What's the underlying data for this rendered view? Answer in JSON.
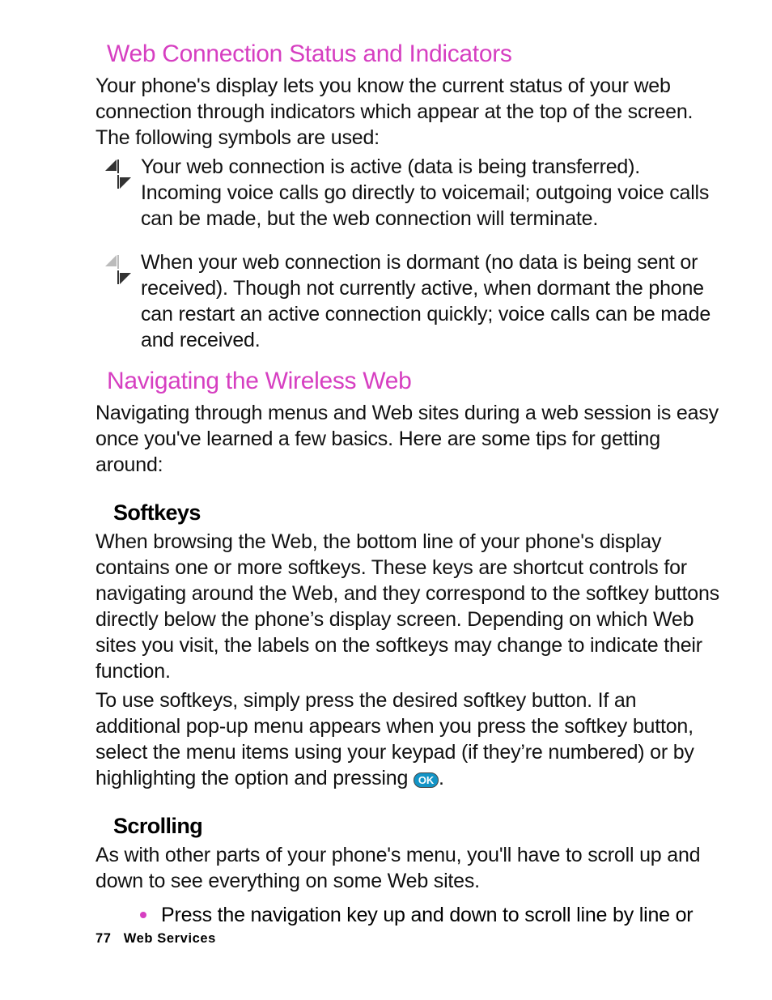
{
  "sections": {
    "webConn": {
      "title": "Web Connection Status and Indicators",
      "intro": "Your phone's display lets you know the current status of your web connection through indicators which appear at the top of the screen. The following symbols are used:",
      "icon1_text": "Your web connection is active (data is being transferred). Incoming voice calls go directly to voicemail; outgoing voice calls can be made, but the web connection will terminate.",
      "icon2_text": "When your web connection is dormant (no data is being sent or received). Though not currently active, when dormant the phone can restart an active connection quickly; voice calls can be made and received."
    },
    "nav": {
      "title": "Navigating the Wireless Web",
      "intro": "Navigating through menus and Web sites during a web session is easy once you've learned a few basics. Here are some tips for getting around:"
    },
    "softkeys": {
      "title": "Softkeys",
      "p1": "When browsing the Web, the bottom line of your phone's display contains one or more softkeys. These keys are shortcut controls for navigating around the Web, and they correspond to the softkey buttons directly below the phone’s display screen. Depending on which Web sites you visit, the labels on the softkeys may change to indicate their function.",
      "p2_a": "To use softkeys, simply press the desired softkey button. If an additional pop-up menu appears when you press the softkey button, select the menu items using your keypad (if they’re numbered) or by highlighting the option and pressing ",
      "p2_ok": "OK",
      "p2_b": "."
    },
    "scrolling": {
      "title": "Scrolling",
      "p1": "As with other parts of your phone's menu, you'll have to scroll up and down to see everything on some Web sites.",
      "bullet1": "Press the navigation key up and down to scroll line by line or"
    }
  },
  "footer": {
    "page": "77",
    "chapter": "Web Services"
  }
}
